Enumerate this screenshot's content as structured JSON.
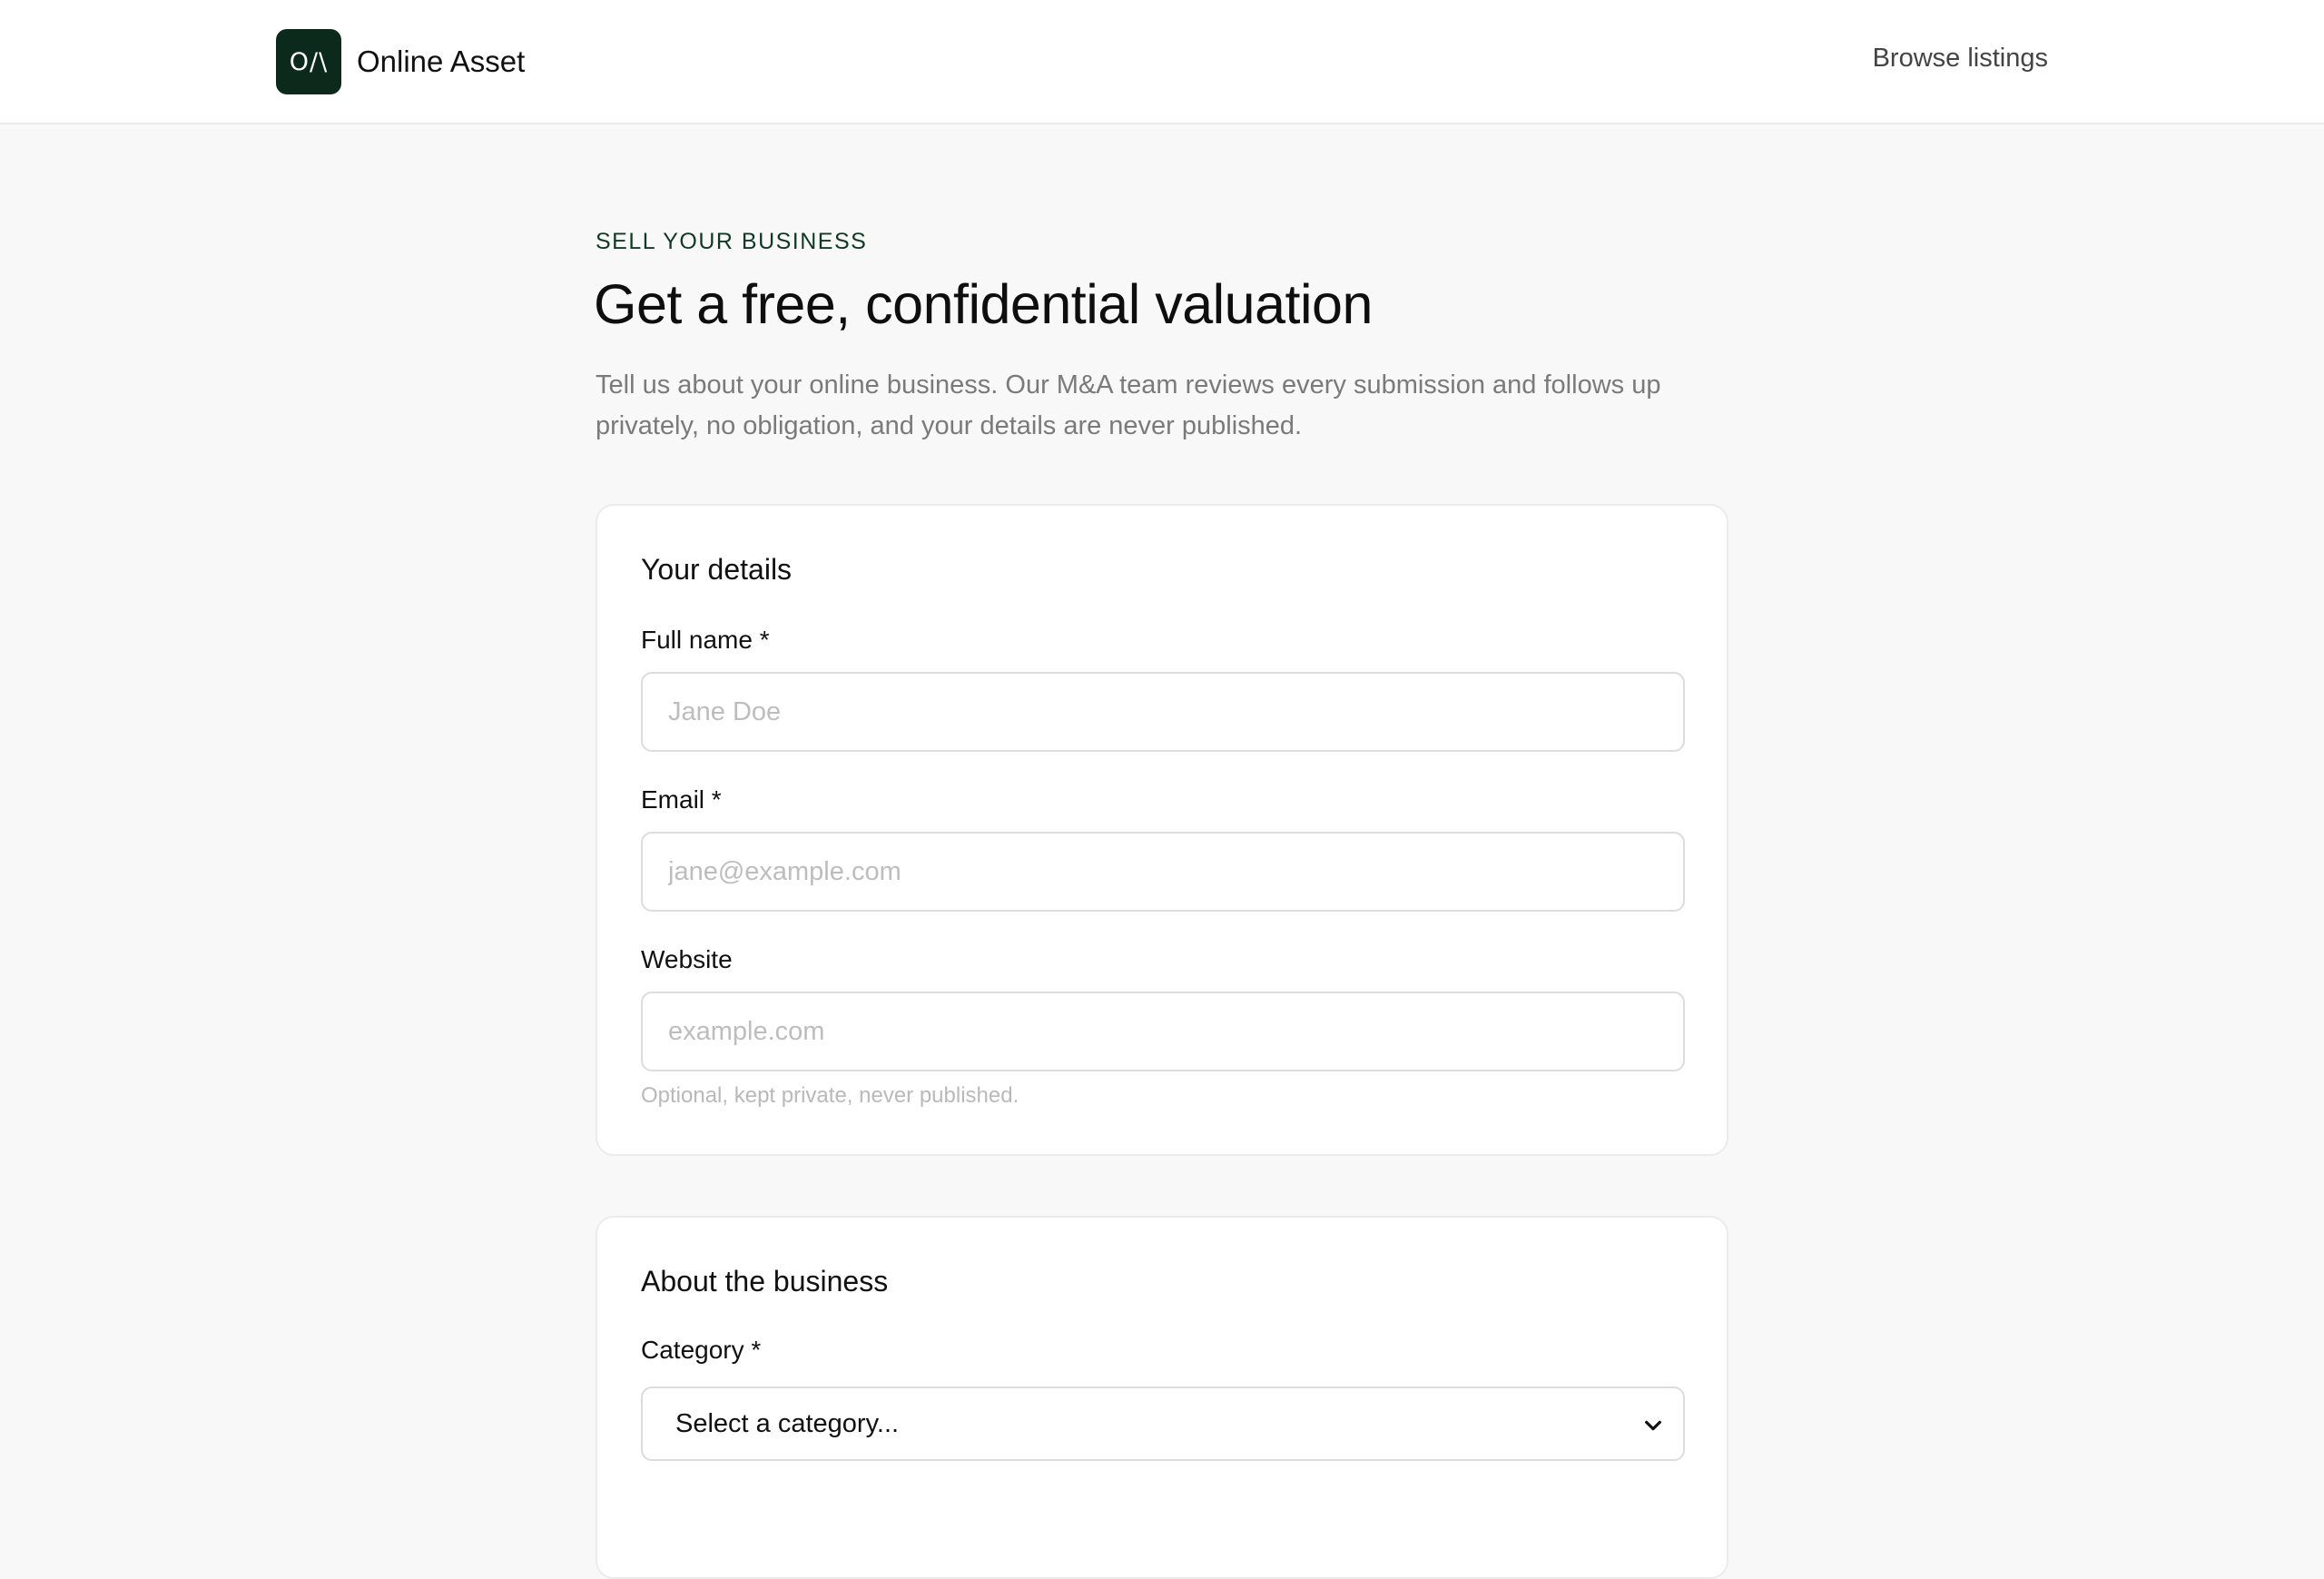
{
  "header": {
    "logo_text": "O/\\",
    "brand_name": "Online Asset",
    "nav_link": "Browse listings"
  },
  "hero": {
    "eyebrow": "SELL YOUR BUSINESS",
    "title": "Get a free, confidential valuation",
    "intro": "Tell us about your online business. Our M&A team reviews every submission and follows up privately, no obligation, and your details are never published."
  },
  "details_section": {
    "title": "Your details",
    "full_name": {
      "label": "Full name *",
      "placeholder": "Jane Doe",
      "value": ""
    },
    "email": {
      "label": "Email *",
      "placeholder": "jane@example.com",
      "value": ""
    },
    "website": {
      "label": "Website",
      "placeholder": "example.com",
      "value": "",
      "hint": "Optional, kept private, never published."
    }
  },
  "business_section": {
    "title": "About the business",
    "category": {
      "label": "Category *",
      "selected": "Select a category..."
    }
  },
  "colors": {
    "brand": "#0b2a1c",
    "eyebrow": "#0f3a26",
    "page_background": "#f8f8f8",
    "muted_text": "#7a7a7a"
  }
}
